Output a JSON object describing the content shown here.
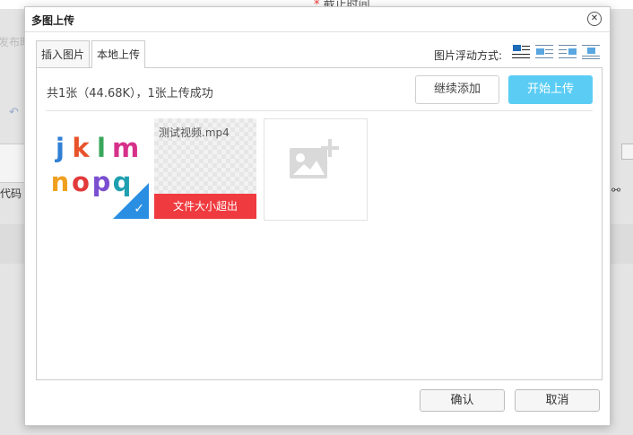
{
  "background": {
    "deadline_required_mark": "*",
    "deadline_label": "截止时间",
    "publish_label": "发布时",
    "code_label": "代码"
  },
  "dialog": {
    "title": "多图上传",
    "close_glyph": "✕",
    "tabs": [
      {
        "label": "插入图片",
        "active": false
      },
      {
        "label": "本地上传",
        "active": true
      }
    ],
    "float_label": "图片浮动方式:",
    "float_options": [
      "none",
      "left",
      "right",
      "center"
    ],
    "float_selected": "none",
    "status_text": "共1张（44.68K），1张上传成功",
    "continue_button": "继续添加",
    "start_button": "开始上传",
    "thumbnails": [
      {
        "kind": "image",
        "letters": [
          "j",
          "k",
          "l",
          "m",
          "n",
          "o",
          "p",
          "q"
        ],
        "status": "uploaded"
      },
      {
        "kind": "file",
        "file_name": "测试视频.mp4",
        "error": "文件大小超出"
      },
      {
        "kind": "add-placeholder"
      }
    ],
    "confirm_button": "确认",
    "cancel_button": "取消"
  },
  "colors": {
    "start_button_bg": "#5bcdf4",
    "error_bar_bg": "#ef3b3f",
    "checkmark_bg": "#2a8fe3",
    "letter_colors": [
      "#2f7fd6",
      "#e8532c",
      "#3aa75c",
      "#d6318a",
      "#f0a020",
      "#e23a3a",
      "#7a4fcf",
      "#1f9fb0"
    ]
  }
}
